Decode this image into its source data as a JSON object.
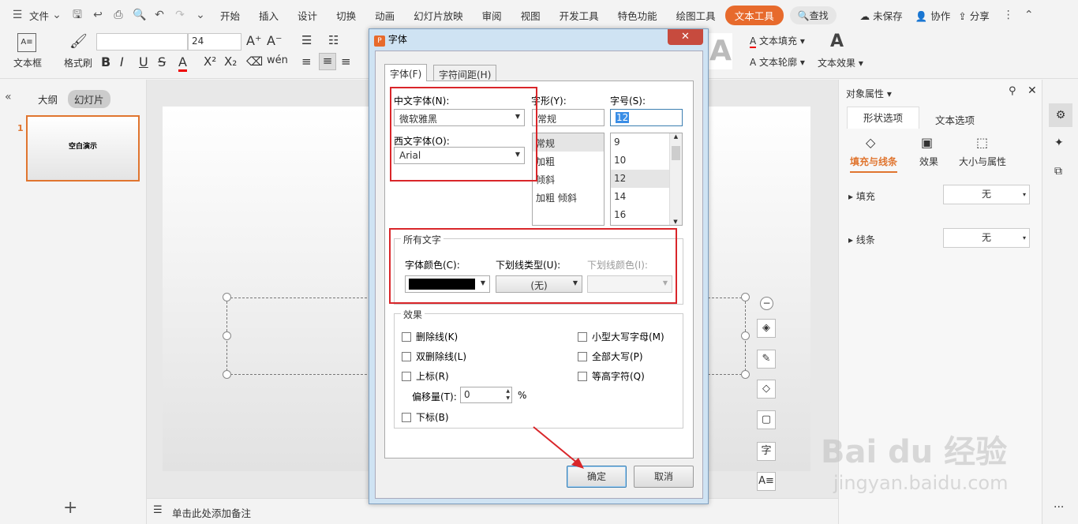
{
  "menubar": {
    "file": "文件",
    "tabs": [
      "开始",
      "插入",
      "设计",
      "切换",
      "动画",
      "幻灯片放映",
      "审阅",
      "视图",
      "开发工具",
      "特色功能"
    ],
    "drawing_tools": "绘图工具",
    "text_tools": "文本工具",
    "search": "查找",
    "unsaved": "未保存",
    "collab": "协作",
    "share": "分享"
  },
  "ribbon": {
    "textbox": "文本框",
    "format_painter": "格式刷",
    "font_size": "24",
    "text_fill": "文本填充",
    "text_outline": "文本轮廓",
    "text_effect": "文本效果"
  },
  "leftpane": {
    "outline": "大纲",
    "slides": "幻灯片",
    "slide_num": "1",
    "thumb_title": "空白演示"
  },
  "notes": {
    "placeholder": "单击此处添加备注"
  },
  "rightpane": {
    "title": "对象属性",
    "tab_shape": "形状选项",
    "tab_text": "文本选项",
    "sub_fill_line": "填充与线条",
    "sub_effect": "效果",
    "sub_size": "大小与属性",
    "fill_label": "填充",
    "fill_value": "无",
    "line_label": "线条",
    "line_value": "无"
  },
  "dialog": {
    "title": "字体",
    "tab_font": "字体(F)",
    "tab_spacing": "字符间距(H)",
    "cn_font_label": "中文字体(N):",
    "cn_font_value": "微软雅黑",
    "west_font_label": "西文字体(O):",
    "west_font_value": "Arial",
    "style_label": "字形(Y):",
    "style_value": "常规",
    "styles": [
      "常规",
      "加粗",
      "倾斜",
      "加粗 倾斜"
    ],
    "size_label": "字号(S):",
    "size_value": "12",
    "sizes": [
      "9",
      "10",
      "12",
      "14",
      "16"
    ],
    "all_text": "所有文字",
    "font_color_label": "字体颜色(C):",
    "underline_label": "下划线类型(U):",
    "underline_value": "(无)",
    "underline_color_label": "下划线颜色(I):",
    "effects": "效果",
    "strike": "删除线(K)",
    "double_strike": "双删除线(L)",
    "superscript": "上标(R)",
    "offset_label": "偏移量(T):",
    "offset_value": "0",
    "percent": "%",
    "subscript": "下标(B)",
    "small_caps": "小型大写字母(M)",
    "all_caps": "全部大写(P)",
    "equal_height": "等高字符(Q)",
    "ok": "确定",
    "cancel": "取消"
  },
  "watermark": {
    "brand": "Bai du 经验",
    "url": "jingyan.baidu.com"
  },
  "colors": {
    "accent": "#e76a2c",
    "highlight_red": "#d9262a",
    "font_color": "#000000"
  }
}
